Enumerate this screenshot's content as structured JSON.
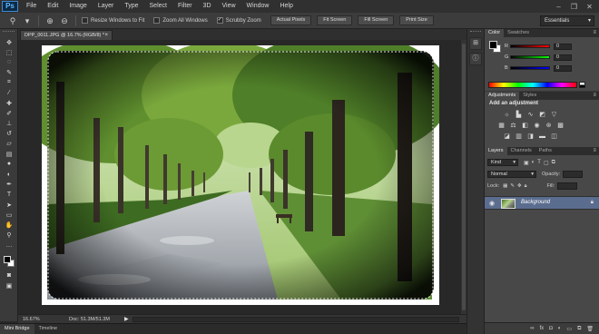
{
  "app": {
    "logo": "Ps",
    "menu": [
      "File",
      "Edit",
      "Image",
      "Layer",
      "Type",
      "Select",
      "Filter",
      "3D",
      "View",
      "Window",
      "Help"
    ]
  },
  "options_bar": {
    "checks": [
      {
        "label": "Resize Windows to Fit",
        "checked": false
      },
      {
        "label": "Zoom All Windows",
        "checked": false
      },
      {
        "label": "Scrubby Zoom",
        "checked": true
      }
    ],
    "buttons": [
      "Actual Pixels",
      "Fit Screen",
      "Fill Screen",
      "Print Size"
    ],
    "workspace": "Essentials"
  },
  "document": {
    "tab_title": "DPP_0011.JPG @ 16.7% (RGB/8) *",
    "zoom": "16.67%",
    "doc_info": "Doc: 51.3M/51.3M"
  },
  "bottom_tabs": [
    "Mini Bridge",
    "Timeline"
  ],
  "color_panel": {
    "tabs": [
      "Color",
      "Swatches"
    ],
    "sliders": [
      {
        "label": "R",
        "value": "0",
        "color": "#ff0000"
      },
      {
        "label": "G",
        "value": "0",
        "color": "#00ff00"
      },
      {
        "label": "B",
        "value": "0",
        "color": "#0000ff"
      }
    ],
    "foreground": "#000000",
    "background": "#ffffff"
  },
  "adjustments_panel": {
    "tabs": [
      "Adjustments",
      "Styles"
    ],
    "title": "Add an adjustment"
  },
  "layers_panel": {
    "tabs": [
      "Layers",
      "Channels",
      "Paths"
    ],
    "filter_kind": "Kind",
    "blend_mode": "Normal",
    "opacity_label": "Opacity:",
    "lock_label": "Lock:",
    "fill_label": "Fill:",
    "layer_name": "Background"
  },
  "colors": {
    "selected_layer": "#5b6d8f",
    "panel_bg": "#484848"
  }
}
